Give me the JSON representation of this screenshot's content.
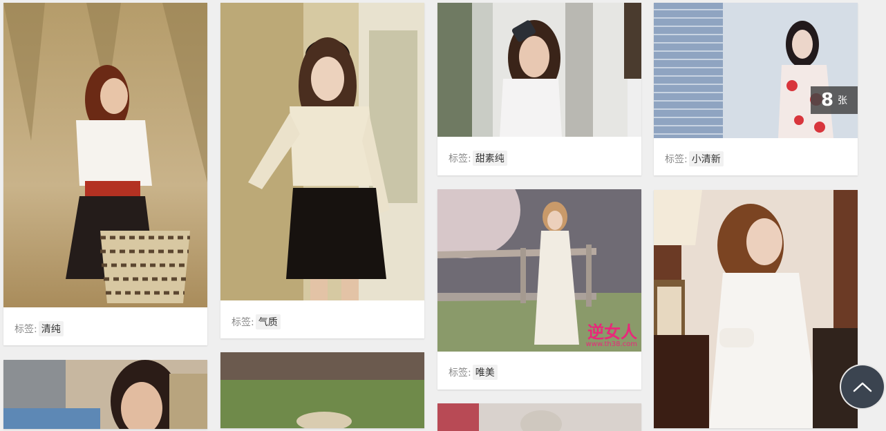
{
  "cards": [
    {
      "tag_prefix": "标签:",
      "tag": "清纯"
    },
    {
      "tag_prefix": "标签:",
      "tag": "气质"
    },
    {
      "tag_prefix": "标签:",
      "tag": "甜素纯"
    },
    {
      "tag_prefix": "标签:",
      "tag": "小清新",
      "badge": {
        "count": "8",
        "unit": "张"
      }
    },
    {
      "tag_prefix": "标签:",
      "tag": "唯美",
      "watermark": {
        "brand": "逆女人",
        "site": "www.th38.com"
      }
    }
  ],
  "icons": {
    "back_to_top": "chevron-up-icon"
  },
  "colors": {
    "card": "#ffffff",
    "page": "#efefef",
    "badge": "#464646",
    "top_button": "#3b4450"
  }
}
